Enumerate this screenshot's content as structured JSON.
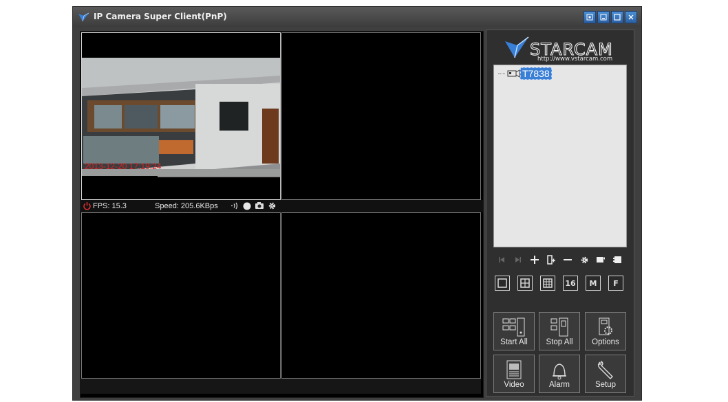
{
  "window": {
    "title": "IP Camera Super Client(PnP)"
  },
  "status_bar": {
    "fps": "FPS: 15.3",
    "speed": "Speed: 205.6KBps"
  },
  "camera_feed": {
    "timestamp": "2013-12-20 17:19:24"
  },
  "logo": {
    "brand": "VSTARCAM",
    "url": "http://www.vstarcam.com"
  },
  "device_tree": {
    "items": [
      {
        "label": "T7838"
      }
    ]
  },
  "layout_buttons": {
    "sixteen": "16",
    "m": "M",
    "f": "F"
  },
  "actions": {
    "start_all": "Start All",
    "stop_all": "Stop All",
    "options": "Options",
    "video": "Video",
    "alarm": "Alarm",
    "setup": "Setup"
  },
  "colors": {
    "frame": "#3f3f3f",
    "titlebar_button": "#3a78c4",
    "tree_selection": "#3a7fd6",
    "power_icon": "#e03030",
    "timestamp": "#e02020"
  }
}
